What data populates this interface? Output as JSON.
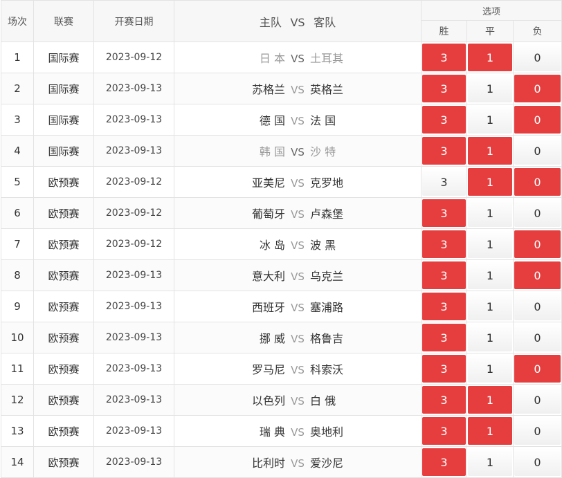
{
  "header": {
    "num": "场次",
    "league": "联赛",
    "date": "开赛日期",
    "home": "主队",
    "vs": "VS",
    "away": "客队",
    "options": "选项",
    "win": "胜",
    "draw": "平",
    "lose": "负"
  },
  "colors": {
    "selected": "#e63e3e",
    "header_bg": "#f7f7f7"
  },
  "rows": [
    {
      "num": "1",
      "league": "国际赛",
      "date": "2023-09-12",
      "home": "日 本",
      "away": "土耳其",
      "dim": true,
      "w": "3",
      "d": "1",
      "l": "0",
      "sel": [
        true,
        true,
        false
      ]
    },
    {
      "num": "2",
      "league": "国际赛",
      "date": "2023-09-13",
      "home": "苏格兰",
      "away": "英格兰",
      "dim": false,
      "w": "3",
      "d": "1",
      "l": "0",
      "sel": [
        true,
        false,
        true
      ]
    },
    {
      "num": "3",
      "league": "国际赛",
      "date": "2023-09-13",
      "home": "德 国",
      "away": "法 国",
      "dim": false,
      "w": "3",
      "d": "1",
      "l": "0",
      "sel": [
        true,
        false,
        true
      ]
    },
    {
      "num": "4",
      "league": "国际赛",
      "date": "2023-09-13",
      "home": "韩 国",
      "away": "沙 特",
      "dim": true,
      "w": "3",
      "d": "1",
      "l": "0",
      "sel": [
        true,
        true,
        false
      ]
    },
    {
      "num": "5",
      "league": "欧预赛",
      "date": "2023-09-12",
      "home": "亚美尼",
      "away": "克罗地",
      "dim": false,
      "w": "3",
      "d": "1",
      "l": "0",
      "sel": [
        false,
        true,
        true
      ]
    },
    {
      "num": "6",
      "league": "欧预赛",
      "date": "2023-09-12",
      "home": "葡萄牙",
      "away": "卢森堡",
      "dim": false,
      "w": "3",
      "d": "1",
      "l": "0",
      "sel": [
        true,
        false,
        false
      ]
    },
    {
      "num": "7",
      "league": "欧预赛",
      "date": "2023-09-12",
      "home": "冰 岛",
      "away": "波 黑",
      "dim": false,
      "w": "3",
      "d": "1",
      "l": "0",
      "sel": [
        true,
        false,
        true
      ]
    },
    {
      "num": "8",
      "league": "欧预赛",
      "date": "2023-09-13",
      "home": "意大利",
      "away": "乌克兰",
      "dim": false,
      "w": "3",
      "d": "1",
      "l": "0",
      "sel": [
        true,
        false,
        true
      ]
    },
    {
      "num": "9",
      "league": "欧预赛",
      "date": "2023-09-13",
      "home": "西班牙",
      "away": "塞浦路",
      "dim": false,
      "w": "3",
      "d": "1",
      "l": "0",
      "sel": [
        true,
        false,
        false
      ]
    },
    {
      "num": "10",
      "league": "欧预赛",
      "date": "2023-09-13",
      "home": "挪 威",
      "away": "格鲁吉",
      "dim": false,
      "w": "3",
      "d": "1",
      "l": "0",
      "sel": [
        true,
        false,
        false
      ]
    },
    {
      "num": "11",
      "league": "欧预赛",
      "date": "2023-09-13",
      "home": "罗马尼",
      "away": "科索沃",
      "dim": false,
      "w": "3",
      "d": "1",
      "l": "0",
      "sel": [
        true,
        false,
        true
      ]
    },
    {
      "num": "12",
      "league": "欧预赛",
      "date": "2023-09-13",
      "home": "以色列",
      "away": "白 俄",
      "dim": false,
      "w": "3",
      "d": "1",
      "l": "0",
      "sel": [
        true,
        true,
        false
      ]
    },
    {
      "num": "13",
      "league": "欧预赛",
      "date": "2023-09-13",
      "home": "瑞 典",
      "away": "奥地利",
      "dim": false,
      "w": "3",
      "d": "1",
      "l": "0",
      "sel": [
        true,
        true,
        false
      ]
    },
    {
      "num": "14",
      "league": "欧预赛",
      "date": "2023-09-13",
      "home": "比利时",
      "away": "爱沙尼",
      "dim": false,
      "w": "3",
      "d": "1",
      "l": "0",
      "sel": [
        true,
        false,
        false
      ]
    }
  ]
}
